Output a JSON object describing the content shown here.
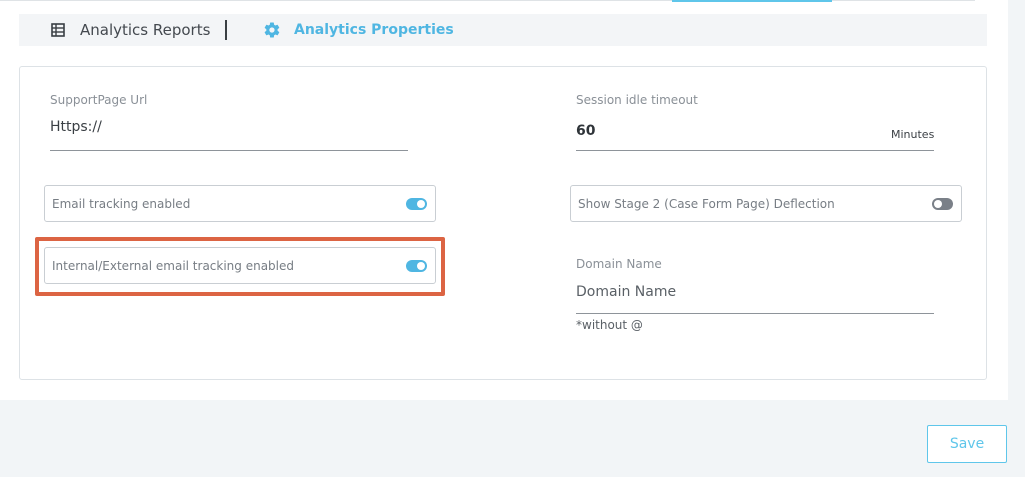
{
  "tabs": {
    "reports": {
      "label": "Analytics Reports",
      "icon": "table-icon"
    },
    "properties": {
      "label": "Analytics Properties",
      "icon": "gear-icon"
    }
  },
  "form": {
    "support_url": {
      "label": "SupportPage Url",
      "value": "Https://"
    },
    "session_timeout": {
      "label": "Session idle timeout",
      "value": "60",
      "unit": "Minutes"
    },
    "email_tracking": {
      "label": "Email tracking enabled",
      "enabled": true
    },
    "stage2_deflection": {
      "label": "Show Stage 2 (Case Form Page) Deflection",
      "enabled": false
    },
    "internal_external_tracking": {
      "label": "Internal/External email tracking enabled",
      "enabled": true
    },
    "domain_name": {
      "label": "Domain Name",
      "placeholder": "Domain Name",
      "hint": "*without @"
    }
  },
  "actions": {
    "save_label": "Save"
  },
  "colors": {
    "accent": "#4fb6e2",
    "highlight": "#dc6443"
  }
}
